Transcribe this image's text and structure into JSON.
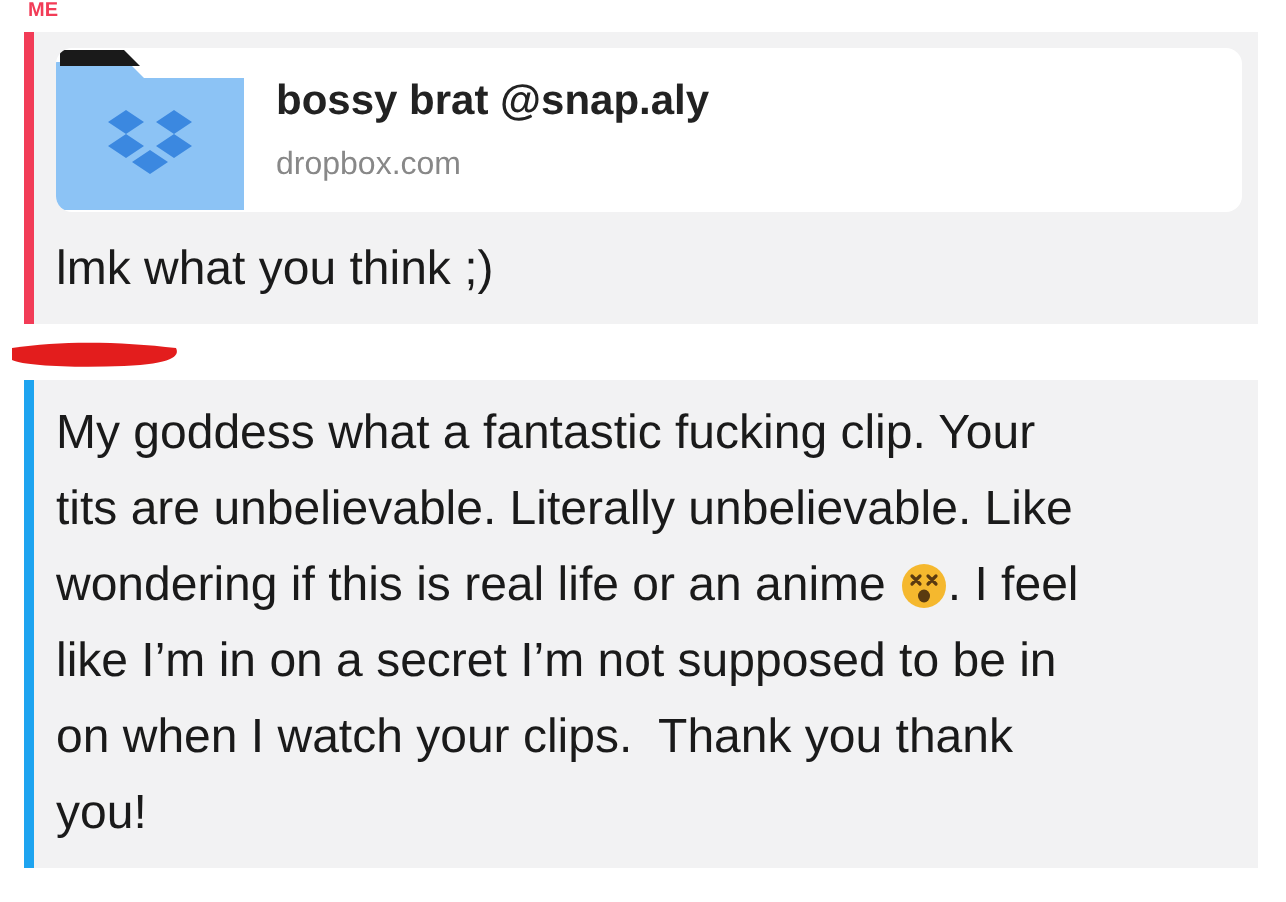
{
  "messages": [
    {
      "sender": "ME",
      "color": "#f23c57",
      "redacted": false,
      "link": {
        "title": "bossy brat @snap.aly",
        "domain": "dropbox.com"
      },
      "lines": [
        [
          "lmk what you think ;)"
        ]
      ]
    },
    {
      "color": "#1ea4f0",
      "redacted": true,
      "lines": [
        [
          "My goddess what a fantastic fucking clip. Your"
        ],
        [
          "tits are unbelievable. Literally unbelievable. Like"
        ],
        [
          "wondering if this is real life or an anime",
          ". I feel"
        ],
        [
          "like I’m in on a secret I’m not supposed to be in"
        ],
        [
          "on when I watch your clips.  Thank you thank"
        ],
        [
          "you!"
        ]
      ]
    }
  ]
}
